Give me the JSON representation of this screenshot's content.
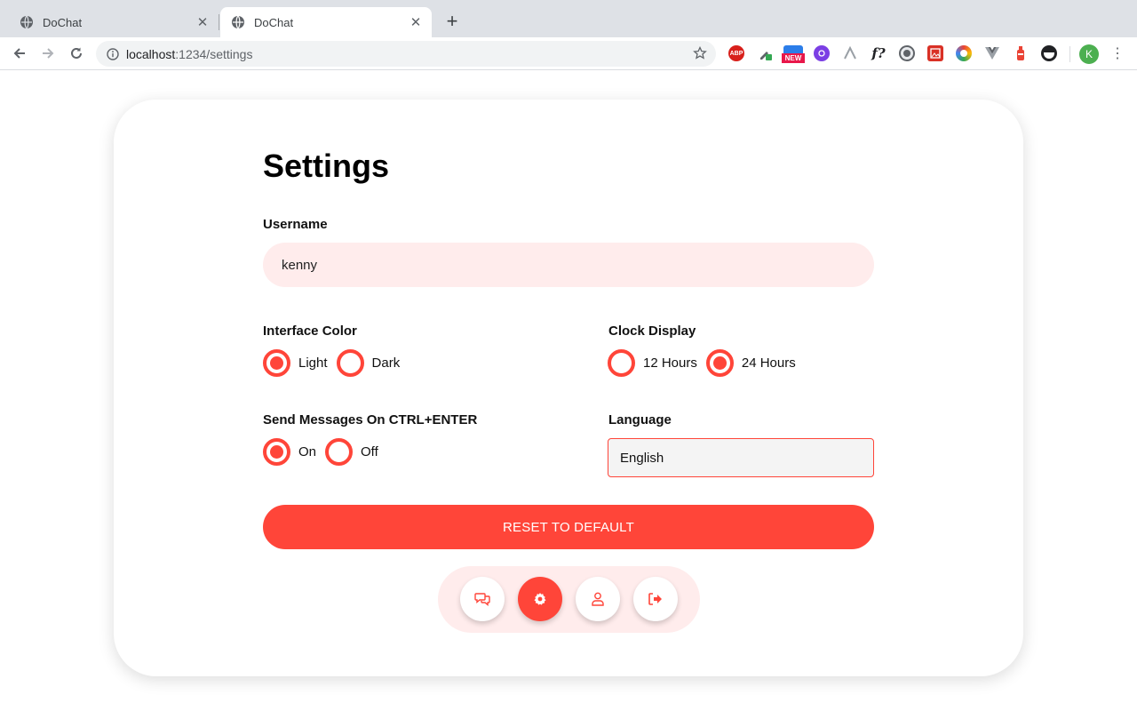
{
  "browser": {
    "tabs": [
      {
        "title": "DoChat",
        "active": false
      },
      {
        "title": "DoChat",
        "active": true
      }
    ],
    "url_host": "localhost",
    "url_path": ":1234/settings",
    "profile_initial": "K",
    "extensions": [
      "ABP",
      "NEW"
    ]
  },
  "settings": {
    "title": "Settings",
    "username": {
      "label": "Username",
      "value": "kenny"
    },
    "interface_color": {
      "label": "Interface Color",
      "options": [
        "Light",
        "Dark"
      ],
      "selected": "Light"
    },
    "clock_display": {
      "label": "Clock Display",
      "options": [
        "12 Hours",
        "24 Hours"
      ],
      "selected": "24 Hours"
    },
    "send_on_ctrl_enter": {
      "label": "Send Messages On CTRL+ENTER",
      "options": [
        "On",
        "Off"
      ],
      "selected": "On"
    },
    "language": {
      "label": "Language",
      "value": "English"
    },
    "reset_label": "RESET TO DEFAULT"
  },
  "nav": {
    "items": [
      {
        "icon": "chat-icon",
        "active": false
      },
      {
        "icon": "gear-icon",
        "active": true
      },
      {
        "icon": "user-icon",
        "active": false
      },
      {
        "icon": "logout-icon",
        "active": false
      }
    ]
  },
  "colors": {
    "accent": "#ff4539",
    "accent_soft": "#ffecec"
  }
}
